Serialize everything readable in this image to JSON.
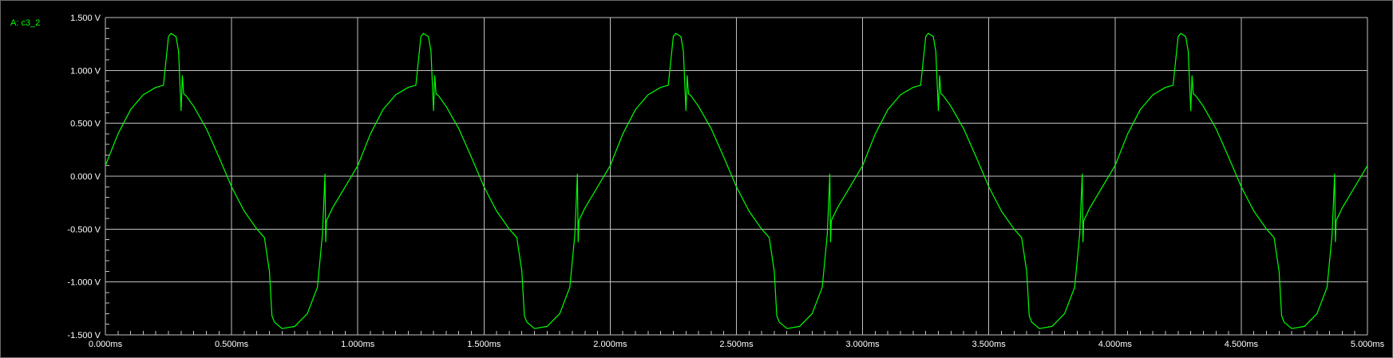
{
  "trace_label": "A: c3_2",
  "colors": {
    "background": "#000000",
    "grid": "#c0c0c0",
    "trace": "#00ff00",
    "text": "#ffffff"
  },
  "chart_data": {
    "type": "line",
    "title": "",
    "xlabel": "",
    "ylabel": "",
    "xlim": [
      0,
      5
    ],
    "ylim": [
      -1.5,
      1.5
    ],
    "grid": true,
    "x_unit": "ms",
    "y_unit": "V",
    "xtick_labels": [
      "0.000ms",
      "0.500ms",
      "1.000ms",
      "1.500ms",
      "2.000ms",
      "2.500ms",
      "3.000ms",
      "3.500ms",
      "4.000ms",
      "4.500ms",
      "5.000ms"
    ],
    "ytick_labels": [
      "1.500 V",
      "1.000 V",
      "0.500 V",
      "0.000 V",
      "-0.500 V",
      "-1.000 V",
      "-1.500 V"
    ],
    "ytick_values": [
      1.5,
      1.0,
      0.5,
      0.0,
      -0.5,
      -1.0,
      -1.5
    ],
    "xtick_values": [
      0,
      0.5,
      1.0,
      1.5,
      2.0,
      2.5,
      3.0,
      3.5,
      4.0,
      4.5,
      5.0
    ],
    "series": [
      {
        "name": "A: c3_2",
        "x": [
          0.0,
          0.05,
          0.1,
          0.15,
          0.2,
          0.23,
          0.25,
          0.26,
          0.28,
          0.29,
          0.3,
          0.305,
          0.31,
          0.32,
          0.35,
          0.4,
          0.45,
          0.5,
          0.55,
          0.6,
          0.63,
          0.65,
          0.66,
          0.67,
          0.7,
          0.75,
          0.8,
          0.84,
          0.86,
          0.87,
          0.873,
          0.876,
          0.88,
          0.9,
          0.95,
          1.0,
          1.05,
          1.1,
          1.15,
          1.2,
          1.23,
          1.25,
          1.26,
          1.28,
          1.29,
          1.3,
          1.305,
          1.31,
          1.32,
          1.35,
          1.4,
          1.45,
          1.5,
          1.55,
          1.6,
          1.63,
          1.65,
          1.66,
          1.67,
          1.7,
          1.75,
          1.8,
          1.84,
          1.86,
          1.87,
          1.873,
          1.876,
          1.88,
          1.9,
          1.95,
          2.0,
          2.05,
          2.1,
          2.15,
          2.2,
          2.23,
          2.25,
          2.26,
          2.28,
          2.29,
          2.3,
          2.305,
          2.31,
          2.32,
          2.35,
          2.4,
          2.45,
          2.5,
          2.55,
          2.6,
          2.63,
          2.65,
          2.66,
          2.67,
          2.7,
          2.75,
          2.8,
          2.84,
          2.86,
          2.87,
          2.873,
          2.876,
          2.88,
          2.9,
          2.95,
          3.0,
          3.05,
          3.1,
          3.15,
          3.2,
          3.23,
          3.25,
          3.26,
          3.28,
          3.29,
          3.3,
          3.305,
          3.31,
          3.32,
          3.35,
          3.4,
          3.45,
          3.5,
          3.55,
          3.6,
          3.63,
          3.65,
          3.66,
          3.67,
          3.7,
          3.75,
          3.8,
          3.84,
          3.86,
          3.87,
          3.873,
          3.876,
          3.88,
          3.9,
          3.95,
          4.0,
          4.05,
          4.1,
          4.15,
          4.2,
          4.23,
          4.25,
          4.26,
          4.28,
          4.29,
          4.3,
          4.305,
          4.31,
          4.32,
          4.35,
          4.4,
          4.45,
          4.5,
          4.55,
          4.6,
          4.63,
          4.65,
          4.66,
          4.67,
          4.7,
          4.75,
          4.8,
          4.84,
          4.86,
          4.87,
          4.873,
          4.876,
          4.88,
          4.9,
          4.95,
          5.0
        ],
        "y": [
          0.1,
          0.4,
          0.63,
          0.77,
          0.84,
          0.86,
          1.32,
          1.35,
          1.32,
          1.18,
          0.62,
          0.95,
          0.78,
          0.76,
          0.66,
          0.45,
          0.18,
          -0.1,
          -0.33,
          -0.5,
          -0.58,
          -0.9,
          -1.32,
          -1.38,
          -1.44,
          -1.42,
          -1.3,
          -1.05,
          -0.55,
          0.02,
          -0.62,
          -0.42,
          -0.4,
          -0.3,
          -0.1,
          0.1,
          0.4,
          0.63,
          0.77,
          0.84,
          0.86,
          1.32,
          1.35,
          1.32,
          1.18,
          0.62,
          0.95,
          0.78,
          0.76,
          0.66,
          0.45,
          0.18,
          -0.1,
          -0.33,
          -0.5,
          -0.58,
          -0.9,
          -1.32,
          -1.38,
          -1.44,
          -1.42,
          -1.3,
          -1.05,
          -0.55,
          0.02,
          -0.62,
          -0.42,
          -0.4,
          -0.3,
          -0.1,
          0.1,
          0.4,
          0.63,
          0.77,
          0.84,
          0.86,
          1.32,
          1.35,
          1.32,
          1.18,
          0.62,
          0.95,
          0.78,
          0.76,
          0.66,
          0.45,
          0.18,
          -0.1,
          -0.33,
          -0.5,
          -0.58,
          -0.9,
          -1.32,
          -1.38,
          -1.44,
          -1.42,
          -1.3,
          -1.05,
          -0.55,
          0.02,
          -0.62,
          -0.42,
          -0.4,
          -0.3,
          -0.1,
          0.1,
          0.4,
          0.63,
          0.77,
          0.84,
          0.86,
          1.32,
          1.35,
          1.32,
          1.18,
          0.62,
          0.95,
          0.78,
          0.76,
          0.66,
          0.45,
          0.18,
          -0.1,
          -0.33,
          -0.5,
          -0.58,
          -0.9,
          -1.32,
          -1.38,
          -1.44,
          -1.42,
          -1.3,
          -1.05,
          -0.55,
          0.02,
          -0.62,
          -0.42,
          -0.4,
          -0.3,
          -0.1,
          0.1,
          0.4,
          0.63,
          0.77,
          0.84,
          0.86,
          1.32,
          1.35,
          1.32,
          1.18,
          0.62,
          0.95,
          0.78,
          0.76,
          0.66,
          0.45,
          0.18,
          -0.1,
          -0.33,
          -0.5,
          -0.58,
          -0.9,
          -1.32,
          -1.38,
          -1.44,
          -1.42,
          -1.3,
          -1.05,
          -0.55,
          0.02,
          -0.62,
          -0.42,
          -0.4,
          -0.3,
          -0.1,
          0.1
        ]
      }
    ]
  }
}
